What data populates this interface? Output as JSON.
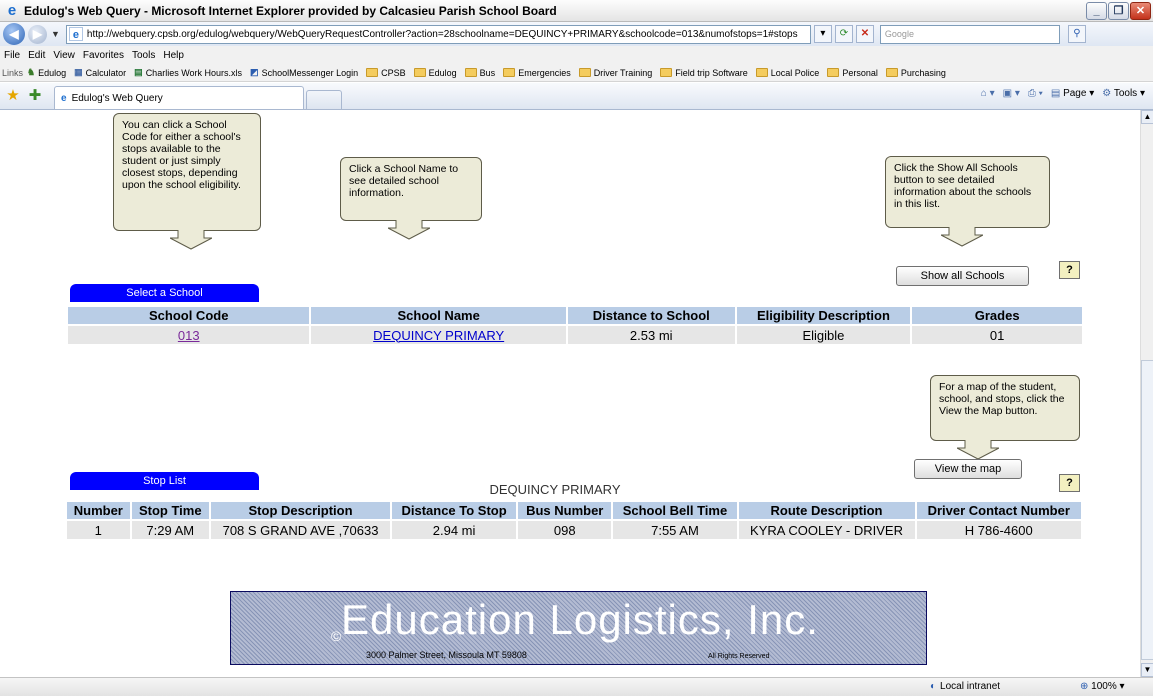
{
  "window": {
    "title": "Edulog's Web Query - Microsoft Internet Explorer provided by Calcasieu Parish School Board"
  },
  "address": {
    "url": "http://webquery.cpsb.org/edulog/webquery/WebQueryRequestController?action=28schoolname=DEQUINCY+PRIMARY&schoolcode=013&numofstops=1#stops",
    "search_placeholder": "Google"
  },
  "menu": [
    "File",
    "Edit",
    "View",
    "Favorites",
    "Tools",
    "Help"
  ],
  "links_bar": {
    "label": "Links",
    "items": [
      "Edulog",
      "Calculator",
      "Charlies Work Hours.xls",
      "SchoolMessenger Login",
      "CPSB",
      "Edulog",
      "Bus",
      "Emergencies",
      "Driver Training",
      "Field trip Software",
      "Local Police",
      "Personal",
      "Purchasing"
    ]
  },
  "tabs": {
    "active": "Edulog's Web Query"
  },
  "command_bar": {
    "page": "Page",
    "tools": "Tools"
  },
  "callouts": {
    "school_code": "You can click a School Code for either a school's stops available to the student or just simply closest stops, depending upon the school eligibility.",
    "school_name": "Click a School Name to see detailed school information.",
    "show_all": "Click the Show All Schools button to see detailed information about the schools in this list.",
    "map": "For a map of the student, school, and stops, click the View the Map button."
  },
  "buttons": {
    "show_all": "Show all Schools",
    "view_map": "View the map",
    "help": "?"
  },
  "school_section": {
    "tab_label": "Select a School",
    "columns": [
      "School Code",
      "School Name",
      "Distance to School",
      "Eligibility Description",
      "Grades"
    ],
    "rows": [
      {
        "code": "013",
        "name": "DEQUINCY PRIMARY",
        "distance": "2.53 mi",
        "eligibility": "Eligible",
        "grades": "01"
      }
    ]
  },
  "stop_section": {
    "tab_label": "Stop List",
    "caption": "DEQUINCY PRIMARY",
    "columns": [
      "Number",
      "Stop Time",
      "Stop Description",
      "Distance To Stop",
      "Bus Number",
      "School Bell Time",
      "Route Description",
      "Driver Contact Number"
    ],
    "rows": [
      [
        "1",
        "7:29 AM",
        "708 S GRAND AVE ,70633",
        "2.94 mi",
        "098",
        "7:55 AM",
        "KYRA COOLEY - DRIVER",
        "H 786-4600"
      ]
    ]
  },
  "footer": {
    "brand": "Education Logistics, Inc.",
    "copyright_symbol": "©",
    "address": "3000 Palmer Street, Missoula MT  59808",
    "rights": "All Rights Reserved"
  },
  "status": {
    "zone": "Local intranet",
    "zoom": "100%"
  }
}
